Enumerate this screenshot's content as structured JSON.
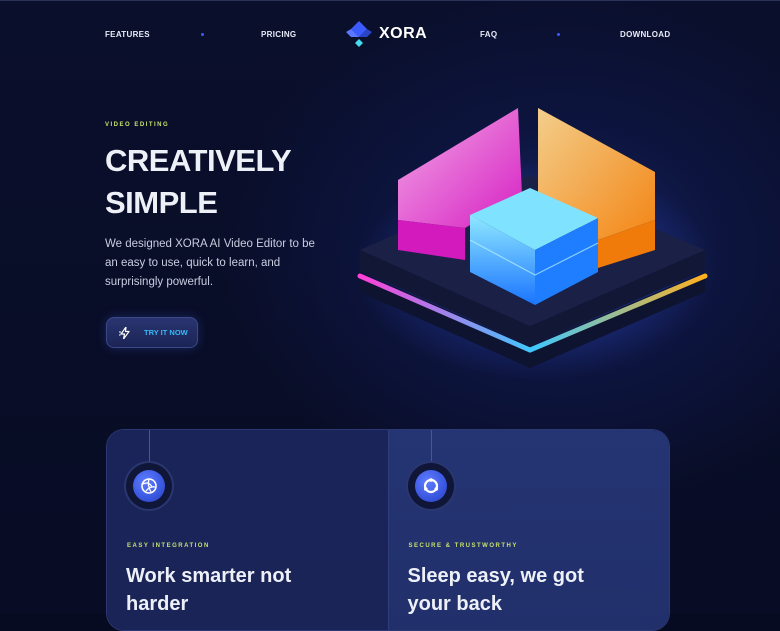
{
  "nav": {
    "links": {
      "features": "FEATURES",
      "pricing": "PRICING",
      "faq": "FAQ",
      "download": "DOWNLOAD"
    },
    "logo_text": "XORA"
  },
  "hero": {
    "eyebrow": "VIDEO EDITING",
    "title_line1": "CREATIVELY",
    "title_line2": "SIMPLE",
    "description": "We designed XORA AI Video Editor to be an easy to use, quick to learn, and surprisingly powerful.",
    "cta_label": "TRY IT NOW",
    "cta_icon": "lightning-icon",
    "art_icon": "glowing-blocks-illustration"
  },
  "features": [
    {
      "eyebrow": "EASY INTEGRATION",
      "title_line1": "Work smarter not",
      "title_line2": "harder",
      "icon": "swirl-icon"
    },
    {
      "eyebrow": "SECURE & TRUSTWORTHY",
      "title_line1": "Sleep easy, we got",
      "title_line2": "your back",
      "icon": "ring-icon"
    }
  ],
  "colors": {
    "background": "#070b22",
    "accent_lime": "#c6e26d",
    "accent_cyan": "#36b8f5",
    "accent_blue": "#3b5bff"
  }
}
